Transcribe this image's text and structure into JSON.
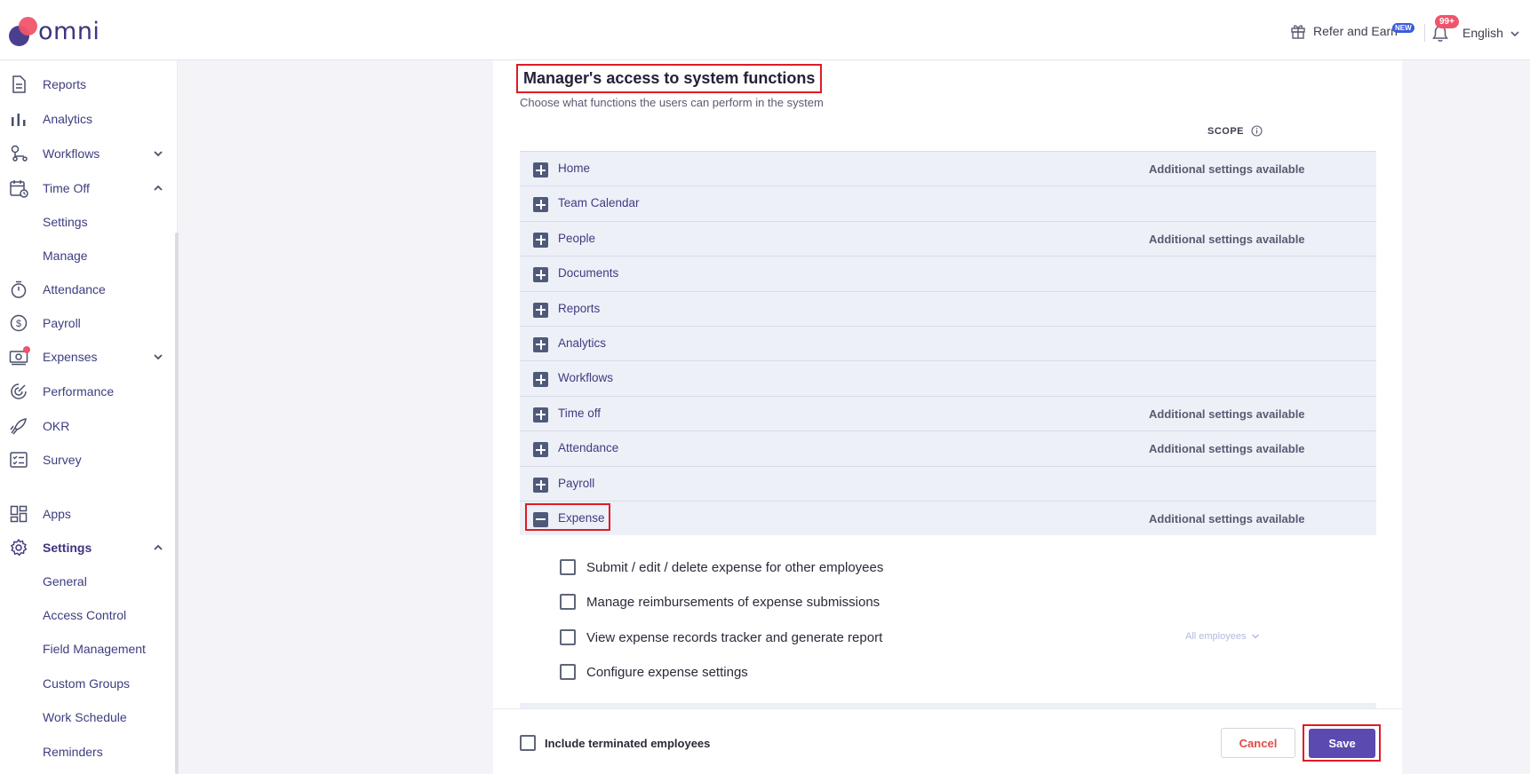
{
  "header": {
    "logo_text": "omni",
    "refer_label": "Refer and Earn",
    "new_badge": "NEW",
    "notification_count": "99+",
    "language": "English"
  },
  "sidebar": {
    "items": [
      {
        "label": "Reports",
        "icon": "document-icon"
      },
      {
        "label": "Analytics",
        "icon": "bar-chart-icon"
      },
      {
        "label": "Workflows",
        "icon": "workflow-icon"
      },
      {
        "label": "Time Off",
        "icon": "calendar-clock-icon"
      },
      {
        "label": "Settings"
      },
      {
        "label": "Manage"
      },
      {
        "label": "Attendance",
        "icon": "stopwatch-icon"
      },
      {
        "label": "Payroll",
        "icon": "dollar-circle-icon"
      },
      {
        "label": "Expenses",
        "icon": "cash-icon"
      },
      {
        "label": "Performance",
        "icon": "target-icon"
      },
      {
        "label": "OKR",
        "icon": "rocket-icon"
      },
      {
        "label": "Survey",
        "icon": "checklist-icon"
      },
      {
        "label": "Apps",
        "icon": "apps-grid-icon"
      },
      {
        "label": "Settings",
        "icon": "gear-icon"
      },
      {
        "label": "General"
      },
      {
        "label": "Access Control"
      },
      {
        "label": "Field Management"
      },
      {
        "label": "Custom Groups"
      },
      {
        "label": "Work Schedule"
      },
      {
        "label": "Reminders"
      }
    ]
  },
  "section": {
    "title": "Manager's access to system functions",
    "subtitle": "Choose what functions the users can perform in the system",
    "scope_label": "SCOPE"
  },
  "functions": [
    {
      "name": "Home",
      "extra": "Additional settings available"
    },
    {
      "name": "Team Calendar",
      "extra": ""
    },
    {
      "name": "People",
      "extra": "Additional settings available"
    },
    {
      "name": "Documents",
      "extra": ""
    },
    {
      "name": "Reports",
      "extra": ""
    },
    {
      "name": "Analytics",
      "extra": ""
    },
    {
      "name": "Workflows",
      "extra": ""
    },
    {
      "name": "Time off",
      "extra": "Additional settings available"
    },
    {
      "name": "Attendance",
      "extra": "Additional settings available"
    },
    {
      "name": "Payroll",
      "extra": ""
    },
    {
      "name": "Expense",
      "extra": "Additional settings available"
    }
  ],
  "expense_permissions": [
    {
      "label": "Submit / edit / delete expense for other employees",
      "checked": false
    },
    {
      "label": "Manage reimbursements of expense submissions",
      "checked": false
    },
    {
      "label": "View expense records tracker and generate report",
      "checked": false
    },
    {
      "label": "Configure expense settings",
      "checked": false
    }
  ],
  "scope_select": "All employees",
  "footer": {
    "include_terminated": "Include terminated employees",
    "cancel_label": "Cancel",
    "save_label": "Save"
  },
  "colors": {
    "brand": "#3d3580",
    "accent_red": "#f0546a",
    "save_button": "#5b4ab0",
    "highlight_border": "#e01b24"
  }
}
